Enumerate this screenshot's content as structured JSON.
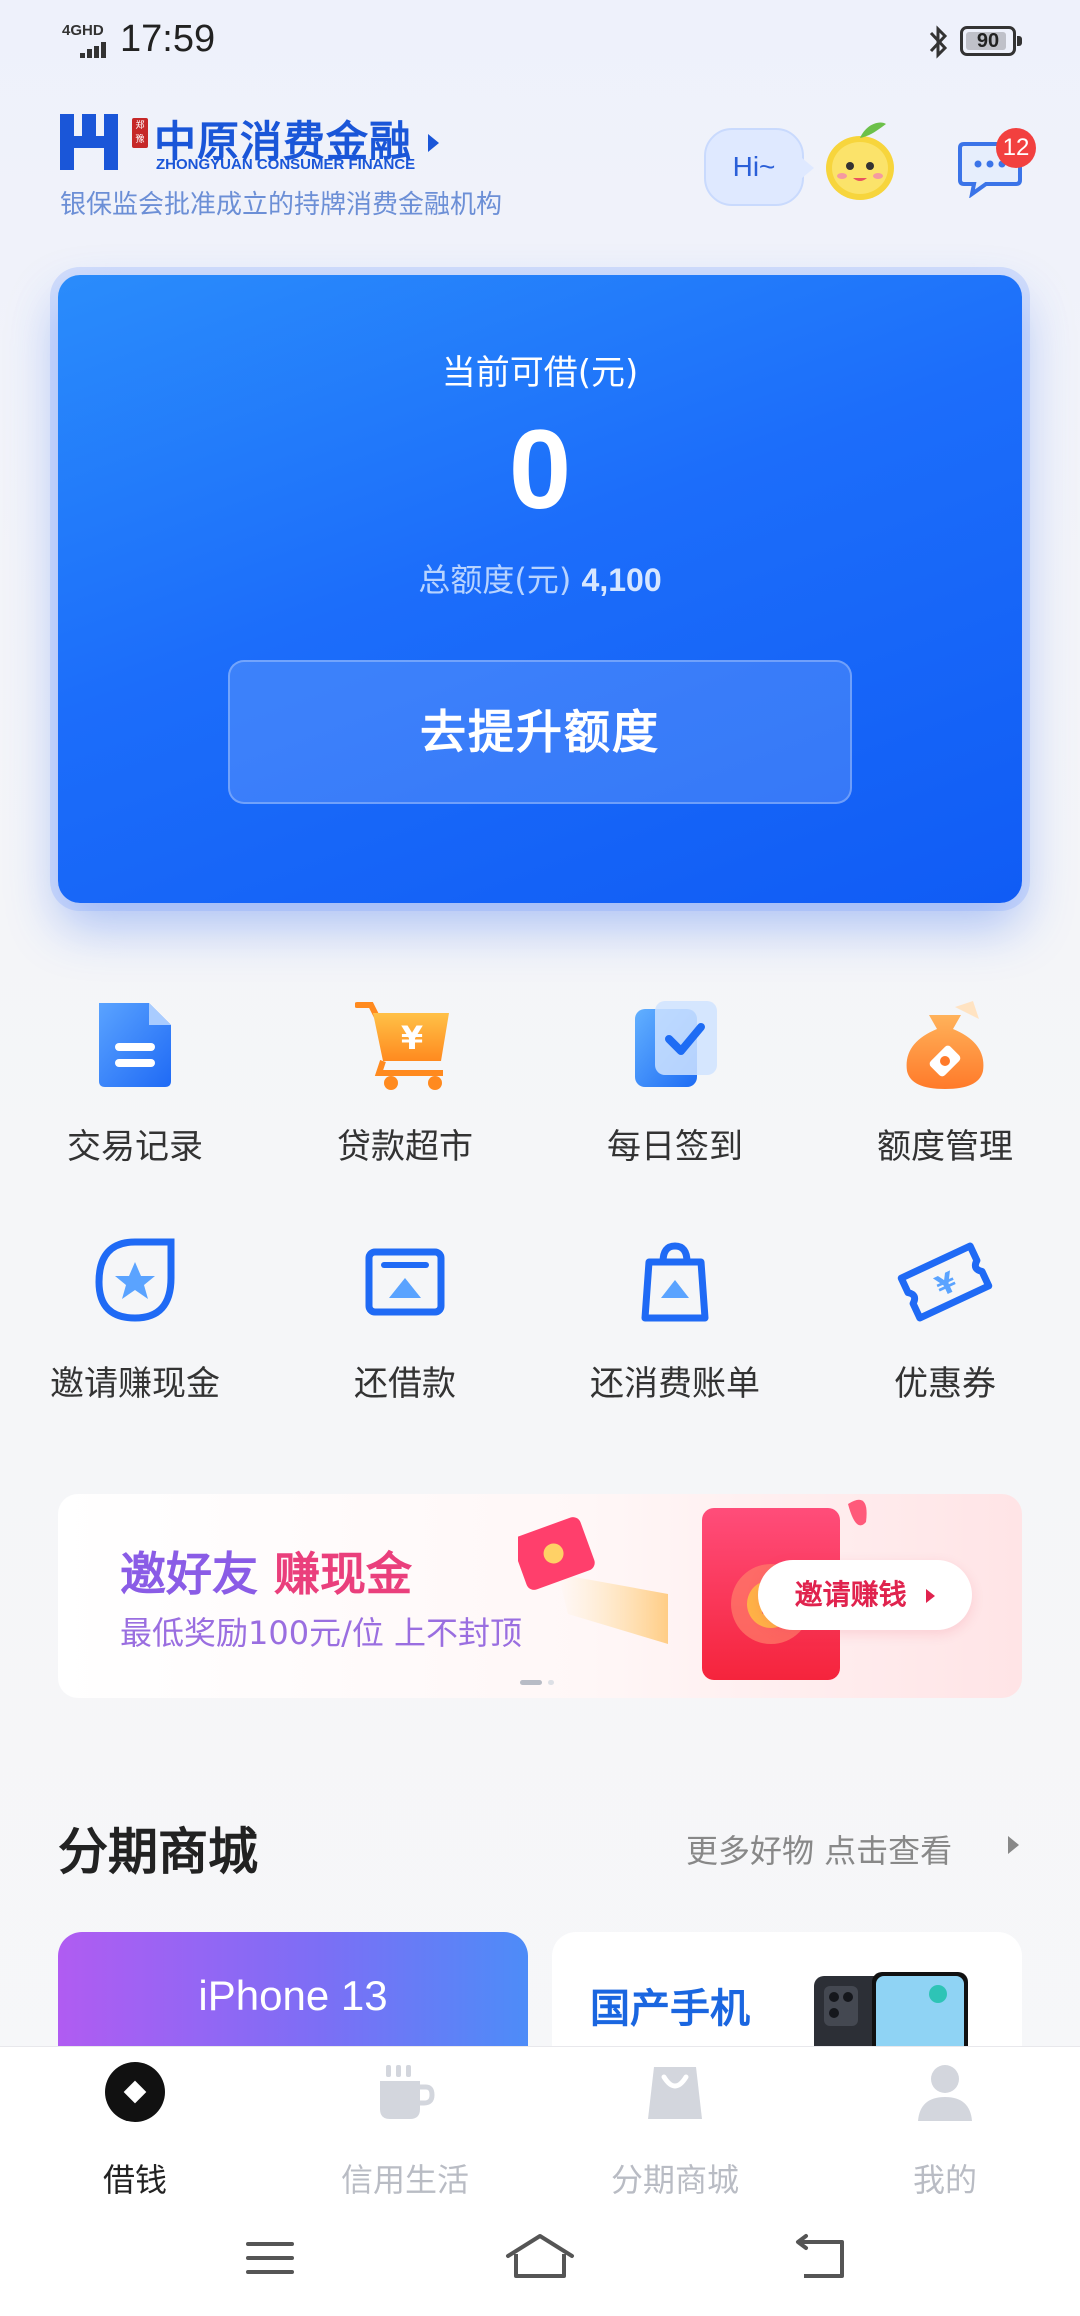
{
  "status_bar": {
    "network": "4GHD",
    "time": "17:59",
    "battery": "90"
  },
  "header": {
    "brand_cn": "中原消费金融",
    "brand_en": "ZHONGYUAN CONSUMER FINANCE",
    "seal_text": "郑豫",
    "tagline": "银保监会批准成立的持牌消费金融机构",
    "greeting": "Hi~",
    "message_badge": "12"
  },
  "credit_card": {
    "label": "当前可借(元)",
    "available": "0",
    "total_label": "总额度(元)",
    "total_value": "4,100",
    "button": "去提升额度"
  },
  "grid": [
    {
      "label": "交易记录",
      "icon": "transaction-record-icon"
    },
    {
      "label": "贷款超市",
      "icon": "loan-market-icon"
    },
    {
      "label": "每日签到",
      "icon": "daily-checkin-icon"
    },
    {
      "label": "额度管理",
      "icon": "limit-manage-icon"
    },
    {
      "label": "邀请赚现金",
      "icon": "invite-icon"
    },
    {
      "label": "还借款",
      "icon": "repay-loan-icon"
    },
    {
      "label": "还消费账单",
      "icon": "repay-bill-icon"
    },
    {
      "label": "优惠券",
      "icon": "coupon-icon"
    }
  ],
  "banner": {
    "title_part1": "邀好友",
    "title_part2": "赚现金",
    "subtitle": "最低奖励100元/位 上不封顶",
    "cta": "邀请赚钱"
  },
  "installment_section": {
    "title": "分期商城",
    "more": "更多好物 点击查看",
    "products": [
      {
        "label": "iPhone 13"
      },
      {
        "label": "国产手机"
      }
    ]
  },
  "tabbar": [
    {
      "label": "借钱",
      "icon": "borrow-icon",
      "active": true
    },
    {
      "label": "信用生活",
      "icon": "coffee-cup-icon",
      "active": false
    },
    {
      "label": "分期商城",
      "icon": "shopping-bag-icon",
      "active": false
    },
    {
      "label": "我的",
      "icon": "profile-icon",
      "active": false
    }
  ],
  "colors": {
    "primary": "#1c6dfa",
    "brand": "#1a56d8",
    "badge": "#f2403f",
    "banner_accent": "#ea3f7c"
  }
}
